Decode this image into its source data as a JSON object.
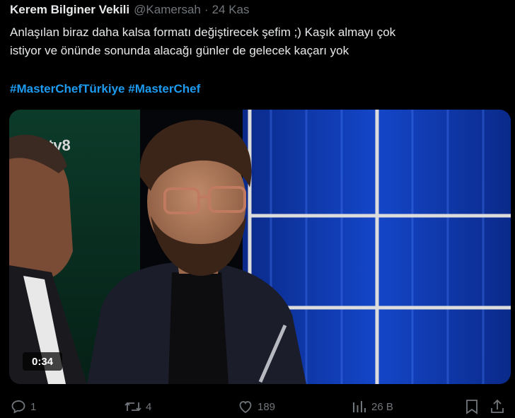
{
  "tweet": {
    "author_name": "Kerem Bilginer Vekili",
    "handle": "@Kamersah",
    "separator": "·",
    "time": "24 Kas",
    "text_line1": "Anlaşılan biraz daha kalsa formatı değiştirecek şefim ;) Kaşık almayı çok",
    "text_line2": "istiyor ve önünde sonunda alacağı günler de gelecek kaçarı yok",
    "hashtags": [
      "#MasterChefTürkiye",
      "#MasterChef"
    ]
  },
  "media": {
    "duration": "0:34",
    "channel_logo_text": "tv8"
  },
  "actions": {
    "reply_count": "1",
    "retweet_count": "4",
    "like_count": "189",
    "views_count": "26 B"
  },
  "colors": {
    "background": "#000000",
    "text_primary": "#e7e9ea",
    "text_secondary": "#71767b",
    "hashtag": "#1d9bf0"
  },
  "icons": [
    "reply-icon",
    "retweet-icon",
    "like-icon",
    "views-icon",
    "bookmark-icon",
    "share-icon"
  ]
}
